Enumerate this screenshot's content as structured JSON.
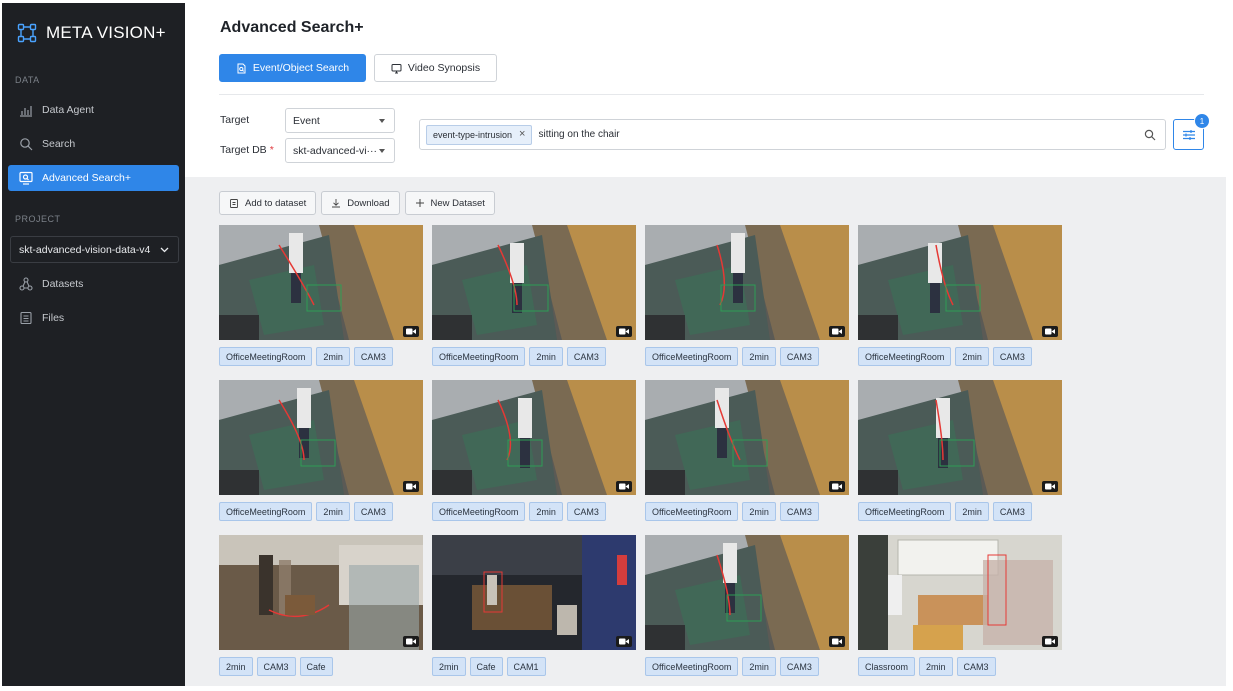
{
  "brand": {
    "name": "META VISION+"
  },
  "sidebar": {
    "data_section": "DATA",
    "project_section": "PROJECT",
    "items": [
      {
        "label": "Data Agent",
        "icon": "bar-chart-icon"
      },
      {
        "label": "Search",
        "icon": "search-icon"
      },
      {
        "label": "Advanced Search+",
        "icon": "monitor-search-icon",
        "active": true
      },
      {
        "label": "Datasets",
        "icon": "nodes-icon"
      },
      {
        "label": "Files",
        "icon": "file-icon"
      }
    ],
    "project_value": "skt-advanced-vision-data-v4"
  },
  "header": {
    "title": "Advanced Search+",
    "tabs": [
      {
        "label": "Event/Object Search",
        "active": true
      },
      {
        "label": "Video Synopsis",
        "active": false
      }
    ]
  },
  "form": {
    "target_label": "Target",
    "target_value": "Event",
    "targetdb_label": "Target DB",
    "targetdb_required": "*",
    "targetdb_value": "skt-advanced-vi···",
    "search_chip": "event-type-intrusion",
    "search_text": "sitting on the chair",
    "filter_count": "1"
  },
  "toolbar": {
    "add_label": "Add to dataset",
    "download_label": "Download",
    "new_label": "New Dataset"
  },
  "results": [
    {
      "tags": [
        "OfficeMeetingRoom",
        "2min",
        "CAM3"
      ],
      "scene": "office"
    },
    {
      "tags": [
        "OfficeMeetingRoom",
        "2min",
        "CAM3"
      ],
      "scene": "office"
    },
    {
      "tags": [
        "OfficeMeetingRoom",
        "2min",
        "CAM3"
      ],
      "scene": "office"
    },
    {
      "tags": [
        "OfficeMeetingRoom",
        "2min",
        "CAM3"
      ],
      "scene": "office"
    },
    {
      "tags": [
        "OfficeMeetingRoom",
        "2min",
        "CAM3"
      ],
      "scene": "office"
    },
    {
      "tags": [
        "OfficeMeetingRoom",
        "2min",
        "CAM3"
      ],
      "scene": "office"
    },
    {
      "tags": [
        "OfficeMeetingRoom",
        "2min",
        "CAM3"
      ],
      "scene": "office"
    },
    {
      "tags": [
        "OfficeMeetingRoom",
        "2min",
        "CAM3"
      ],
      "scene": "office"
    },
    {
      "tags": [
        "2min",
        "CAM3",
        "Cafe"
      ],
      "scene": "cafe-bright"
    },
    {
      "tags": [
        "2min",
        "Cafe",
        "CAM1"
      ],
      "scene": "cafe-dark"
    },
    {
      "tags": [
        "OfficeMeetingRoom",
        "2min",
        "CAM3"
      ],
      "scene": "office"
    },
    {
      "tags": [
        "Classroom",
        "2min",
        "CAM3"
      ],
      "scene": "classroom"
    }
  ],
  "colors": {
    "accent": "#2f86e8",
    "sidebar": "#1e2024",
    "tag_bg": "#d3e3f7"
  }
}
